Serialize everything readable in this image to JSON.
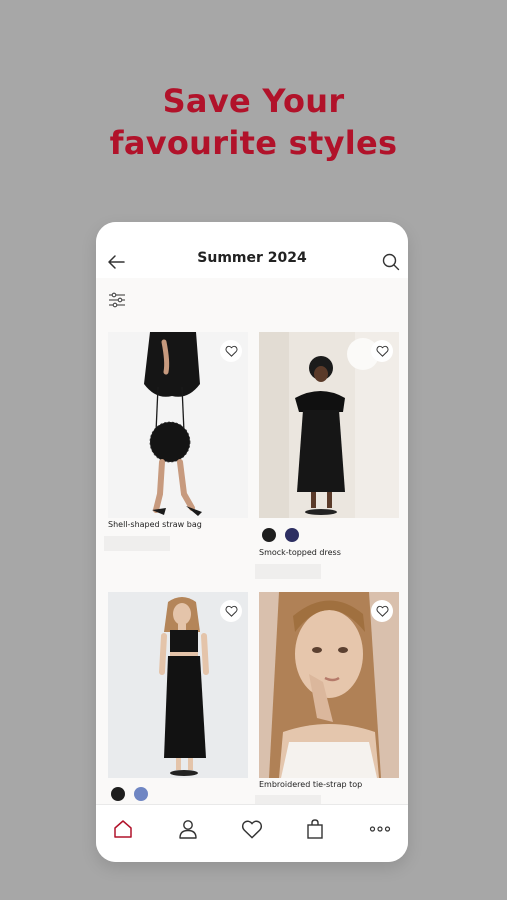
{
  "promo": {
    "headline_line1": "Save Your",
    "headline_line2": "favourite styles",
    "accent_color": "#b1122a"
  },
  "app": {
    "title": "Summer 2024",
    "back_icon": "arrow-left-icon",
    "search_icon": "search-icon",
    "filter_icon": "filter-sliders-icon"
  },
  "products": [
    {
      "name": "Shell-shaped straw bag",
      "swatches": []
    },
    {
      "name": "Smock-topped dress",
      "swatches": [
        "#1e1e1e",
        "#2d2f62"
      ]
    },
    {
      "name": "",
      "swatches": [
        "#1e1e1e",
        "#6f86c3"
      ]
    },
    {
      "name": "Embroidered tie-strap top",
      "swatches": []
    }
  ],
  "bottom_nav": [
    {
      "icon": "home-icon",
      "active": true
    },
    {
      "icon": "account-icon",
      "active": false
    },
    {
      "icon": "favourites-heart-icon",
      "active": false
    },
    {
      "icon": "shopping-bag-icon",
      "active": false
    },
    {
      "icon": "more-icon",
      "active": false
    }
  ]
}
